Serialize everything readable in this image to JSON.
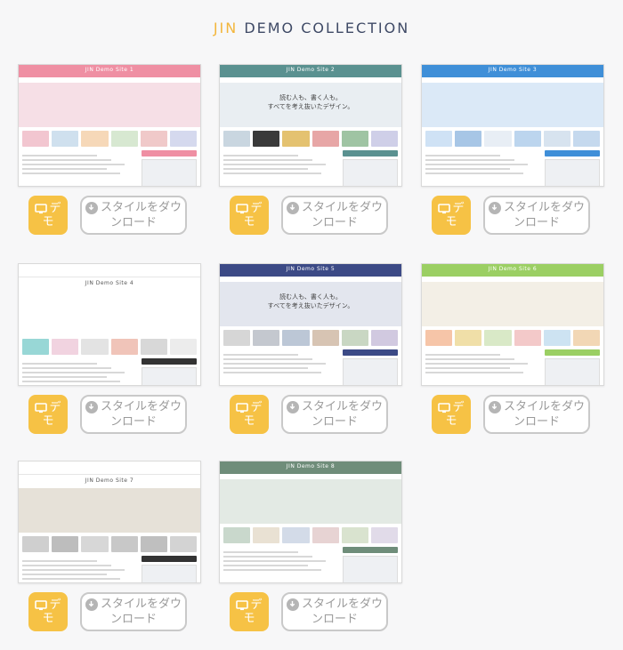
{
  "header": {
    "title_accent": "JIN",
    "title_rest": " DEMO COLLECTION"
  },
  "buttons": {
    "demo_line1": "デ",
    "demo_line2": "モ",
    "dl_line1": "スタイルをダウ",
    "dl_line2": "ンロード"
  },
  "icons": {
    "demo": "monitor-icon",
    "download": "download-circle-icon"
  },
  "colors": {
    "accent": "#f3b63c",
    "demo_button": "#f6c245"
  },
  "sites": [
    {
      "name": "JIN Demo Site 1",
      "color": "#ef8fa3"
    },
    {
      "name": "JIN Demo Site 2",
      "color": "#5a9190"
    },
    {
      "name": "JIN Demo Site 3",
      "color": "#3f8fd8"
    },
    {
      "name": "JIN Demo Site 4",
      "color": "#ffffff"
    },
    {
      "name": "JIN Demo Site 5",
      "color": "#3c4a86",
      "catch1": "読む人も、書く人も。",
      "catch2": "すべてを考え抜いたデザイン。"
    },
    {
      "name": "JIN Demo Site 6",
      "color": "#9bcf63"
    },
    {
      "name": "JIN Demo Site 7",
      "color": "#ffffff"
    },
    {
      "name": "JIN Demo Site 8",
      "color": "#6f8d7a"
    }
  ],
  "site2_catch": {
    "line1": "読む人も、書く人も。",
    "line2": "すべてを考え抜いたデザイン。"
  }
}
